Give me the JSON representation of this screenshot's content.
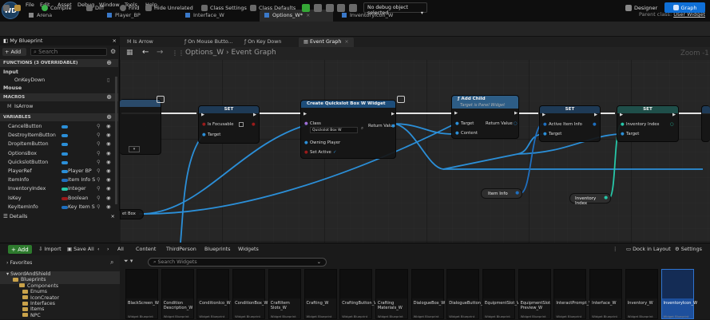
{
  "app": {
    "logo": "WD"
  },
  "menu": [
    "File",
    "Edit",
    "Asset",
    "Debug",
    "Window",
    "Tools",
    "Help"
  ],
  "tabs": [
    {
      "label": "Arena",
      "active": false
    },
    {
      "label": "Player_BP",
      "active": false
    },
    {
      "label": "Interface_W",
      "active": false
    },
    {
      "label": "Options_W*",
      "active": true
    },
    {
      "label": "InventoryIcon_W",
      "active": false
    }
  ],
  "parent_class": {
    "label": "Parent class:",
    "value": "User Widget"
  },
  "toolbar": {
    "compile": "Compile",
    "diff": "Diff",
    "find": "Find",
    "hide_unrelated": "Hide Unrelated",
    "class_settings": "Class Settings",
    "class_defaults": "Class Defaults",
    "debug_select": "No debug object selected",
    "designer": "Designer",
    "graph": "Graph"
  },
  "my_blueprint": {
    "title": "My Blueprint",
    "add": "+ Add",
    "search_placeholder": "Search",
    "sections": {
      "functions": "FUNCTIONS (3 OVERRIDABLE)",
      "macros": "MACROS",
      "variables": "VARIABLES"
    },
    "input": "Input",
    "onkeydown": "OnKeyDown",
    "mouse": "Mouse",
    "isarrow": "IsArrow",
    "variables": [
      {
        "name": "CancelButton",
        "type": "",
        "color": "#2b8fd8"
      },
      {
        "name": "DestroyItemButton",
        "type": "",
        "color": "#2b8fd8"
      },
      {
        "name": "DropItemButton",
        "type": "",
        "color": "#2b8fd8"
      },
      {
        "name": "OptionsBox",
        "type": "",
        "color": "#2b8fd8"
      },
      {
        "name": "QuickslotButton",
        "type": "",
        "color": "#2b8fd8"
      },
      {
        "name": "PlayerRef",
        "type": "Player BP",
        "color": "#2b8fd8"
      },
      {
        "name": "ItemInfo",
        "type": "Item Info S",
        "color": "#1f6fbf"
      },
      {
        "name": "InventoryIndex",
        "type": "Integer",
        "color": "#27c7a8"
      },
      {
        "name": "IsKey",
        "type": "Boolean",
        "color": "#9b1b1b"
      },
      {
        "name": "KeyItemInfo",
        "type": "Key Item S",
        "color": "#1f6fbf"
      }
    ]
  },
  "details": {
    "title": "Details"
  },
  "graph": {
    "tabs": [
      "Is Arrow",
      "On Mouse Butto...",
      "On Key Down",
      "Event Graph"
    ],
    "breadcrumb": "Options_W  ›  Event Graph",
    "zoom": "Zoom -1",
    "nodes": {
      "set1": {
        "title": "SET",
        "is_focusable": "Is Focusable",
        "target": "Target"
      },
      "create": {
        "title": "Create Quickslot Box W Widget",
        "class": "Class",
        "class_value": "Quickslot Box W",
        "return": "Return Value",
        "owning": "Owning Player",
        "set_active": "Set Active"
      },
      "addchild": {
        "title": "Add Child",
        "subtitle": "Target is Panel Widget",
        "target": "Target",
        "content": "Content",
        "return": "Return Value"
      },
      "set2": {
        "title": "SET",
        "active_item": "Active Item Info",
        "target": "Target"
      },
      "set3": {
        "title": "SET",
        "inv_index": "Inventory Index",
        "target": "Target"
      },
      "iteminfo": "Item Info",
      "invindex": "Inventory Index",
      "optbox": "et Box"
    }
  },
  "content_browser": {
    "add": "+ Add",
    "import": "Import",
    "save_all": "Save All",
    "path": [
      "All",
      "Content",
      "ThirdPerson",
      "Blueprints",
      "Widgets"
    ],
    "dock": "Dock in Layout",
    "settings": "Settings",
    "search_placeholder": "Search Widgets",
    "favorites": "Favorites",
    "tree": [
      "SwordAndShield",
      "Blueprints",
      "Components",
      "Enums",
      "IconCreator",
      "Interfaces",
      "Items",
      "NPC"
    ],
    "asset_tag": "Widget Blueprint",
    "assets": [
      "BlackScreen_W",
      "Condition Description_W",
      "ConditionIco_W",
      "ConditionBox_W",
      "CraftItem Slots_W",
      "Crafting_W",
      "CraftingButton_W",
      "Crafting Materials_W",
      "DialogueBox_W",
      "DialogueButton_W",
      "EquipmentSlot_W",
      "EquipmentSlot Preview_W",
      "InteractPrompt_W",
      "Interface_W",
      "Inventory_W",
      "InventoryIcon_W"
    ]
  },
  "colors": {
    "accent": "#0f6fd6",
    "exec": "#ffffff",
    "object": "#2b8fd8",
    "integer": "#27c7a8",
    "bool": "#9b1b1b",
    "struct": "#1f6fbf"
  }
}
